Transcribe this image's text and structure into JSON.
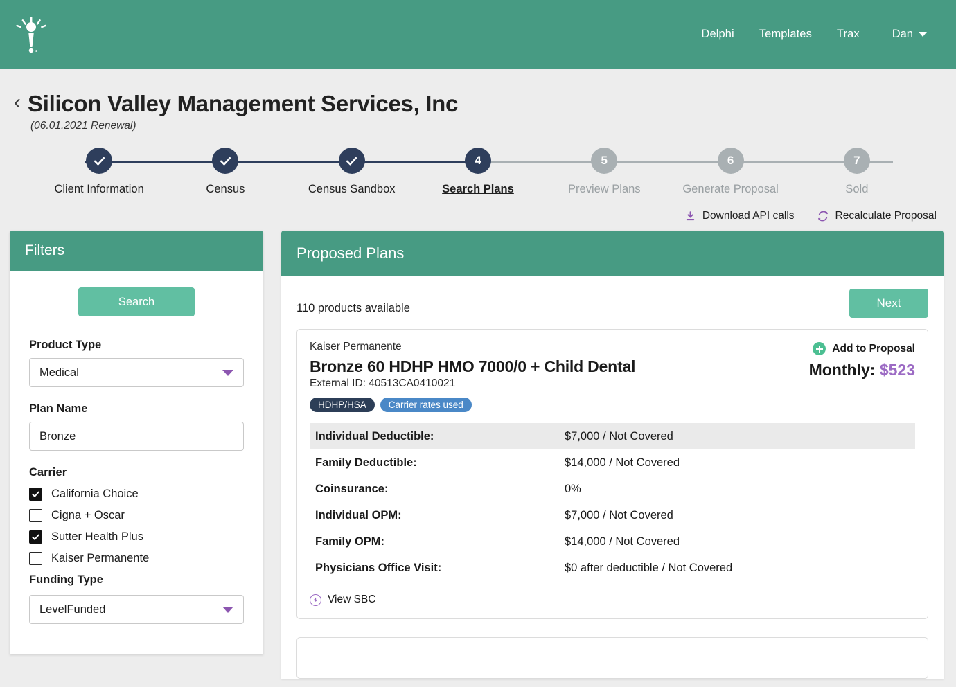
{
  "topnav": {
    "logo_name": "torch-logo",
    "links": [
      {
        "label": "Delphi"
      },
      {
        "label": "Templates"
      },
      {
        "label": "Trax"
      }
    ],
    "user": "Dan"
  },
  "header": {
    "back_chevron": "‹",
    "title": "Silicon Valley Management Services, Inc",
    "subtitle": "(06.01.2021 Renewal)"
  },
  "stepper": {
    "steps": [
      {
        "num": "1",
        "label": "Client Information",
        "state": "done"
      },
      {
        "num": "2",
        "label": "Census",
        "state": "done"
      },
      {
        "num": "3",
        "label": "Census Sandbox",
        "state": "done"
      },
      {
        "num": "4",
        "label": "Search Plans",
        "state": "current"
      },
      {
        "num": "5",
        "label": "Preview Plans",
        "state": "todo"
      },
      {
        "num": "6",
        "label": "Generate Proposal",
        "state": "todo"
      },
      {
        "num": "7",
        "label": "Sold",
        "state": "todo"
      }
    ]
  },
  "actions": {
    "download_label": "Download API calls",
    "download_icon": "download-icon",
    "recalculate_label": "Recalculate Proposal",
    "recalculate_icon": "refresh-icon"
  },
  "filters": {
    "title": "Filters",
    "search_button": "Search",
    "product_type_label": "Product Type",
    "product_type_value": "Medical",
    "plan_name_label": "Plan Name",
    "plan_name_value": "Bronze",
    "carrier_label": "Carrier",
    "carriers": [
      {
        "label": "California Choice",
        "checked": true
      },
      {
        "label": "Cigna + Oscar",
        "checked": false
      },
      {
        "label": "Sutter Health Plus",
        "checked": true
      },
      {
        "label": "Kaiser Permanente",
        "checked": false
      }
    ],
    "funding_type_label": "Funding Type",
    "funding_type_value": "LevelFunded"
  },
  "plans": {
    "title": "Proposed Plans",
    "count_text": "110 products available",
    "next_button": "Next",
    "card": {
      "carrier": "Kaiser Permanente",
      "plan_name": "Bronze 60 HDHP HMO 7000/0 + Child Dental",
      "external_id": "External ID: 40513CA0410021",
      "badges": [
        {
          "label": "HDHP/HSA",
          "style": "dark"
        },
        {
          "label": "Carrier rates used",
          "style": "blue"
        }
      ],
      "add_label": "Add to Proposal",
      "monthly_label": "Monthly:",
      "monthly_amount": "$523",
      "benefits": [
        {
          "label": "Individual Deductible:",
          "value": "$7,000 / Not Covered"
        },
        {
          "label": "Family Deductible:",
          "value": "$14,000 / Not Covered"
        },
        {
          "label": "Coinsurance:",
          "value": "0%"
        },
        {
          "label": "Individual OPM:",
          "value": "$7,000 / Not Covered"
        },
        {
          "label": "Family OPM:",
          "value": "$14,000 / Not Covered"
        },
        {
          "label": "Physicians Office Visit:",
          "value": "$0 after deductible / Not Covered"
        }
      ],
      "view_sbc_label": "View SBC"
    }
  },
  "colors": {
    "brand_teal": "#479b83",
    "accent_green": "#61bfa2",
    "step_active": "#2e3e5c",
    "step_inactive": "#a9b0b3",
    "purple": "#9c6bc4",
    "badge_dark": "#2c3e57",
    "badge_blue": "#4a88c7"
  }
}
